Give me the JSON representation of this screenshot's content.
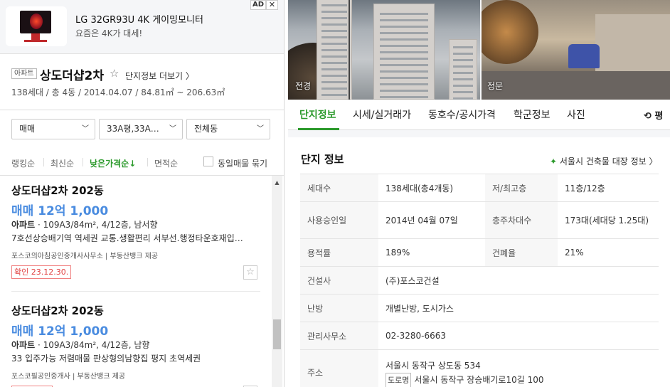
{
  "ad": {
    "title": "LG 32GR93U 4K 게이밍모니터",
    "desc": "요즘은 4K가 대세!",
    "badge": "AD",
    "close": "✕"
  },
  "complex": {
    "type_badge": "아파트",
    "name": "상도더샵2차",
    "star": "☆",
    "detail_link": "단지정보 더보기 〉",
    "summary": "138세대 / 총 4동 / 2014.04.07 / 84.81㎡ ~ 206.63㎡"
  },
  "filters": {
    "trade": "매매",
    "area": "33A평,33A…",
    "dong": "전체동"
  },
  "sort": {
    "items": [
      "랭킹순",
      "최신순",
      "낮은가격순↓",
      "면적순"
    ],
    "group_same": "동일매물 묶기"
  },
  "listings": [
    {
      "title": "상도더샵2차 202동",
      "price": "매매 12억 1,000",
      "type": "아파트",
      "spec": " · 109A3/84m², 4/12층, 남서향",
      "desc": "7호선상승배기역 역세권 교통.생활편리 서부선.행정타운호재입…",
      "agent": "포스코의아침공인중개사사무소 | 부동산뱅크 제공",
      "confirm": "확인 23.12.30."
    },
    {
      "title": "상도더샵2차 202동",
      "price": "매매 12억 1,000",
      "type": "아파트",
      "spec": " · 109A3/84m², 4/12층, 남향",
      "desc": "33 입주가능 저렴매물 판상형의남향집 평지 초역세권",
      "agent": "포스코필공인중개사 | 부동산뱅크 제공"
    }
  ],
  "photos": {
    "left_label": "전경",
    "right_label": "정문"
  },
  "tabs": [
    "단지정보",
    "시세/실거래가",
    "동호수/공시가격",
    "학군정보",
    "사진"
  ],
  "tab_extra": "⟲ 평",
  "info": {
    "title": "단지 정보",
    "seoul_link": "서울시 건축물 대장 정보 〉",
    "rows": [
      {
        "k1": "세대수",
        "v1": "138세대(총4개동)",
        "k2": "저/최고층",
        "v2": "11층/12층"
      },
      {
        "k1": "사용승인일",
        "v1": "2014년 04월 07일",
        "k2": "총주차대수",
        "v2": "173대(세대당 1.25대)"
      },
      {
        "k1": "용적률",
        "v1": "189%",
        "k2": "건폐율",
        "v2": "21%"
      },
      {
        "k1": "건설사",
        "v1": "(주)포스코건설"
      },
      {
        "k1": "난방",
        "v1": "개별난방, 도시가스"
      },
      {
        "k1": "관리사무소",
        "v1": "02-3280-6663"
      },
      {
        "k1": "주소",
        "v1": "서울시 동작구 상도동 534",
        "road_tag": "도로명",
        "road": "서울시 동작구 장승배기로10길 100"
      }
    ]
  }
}
